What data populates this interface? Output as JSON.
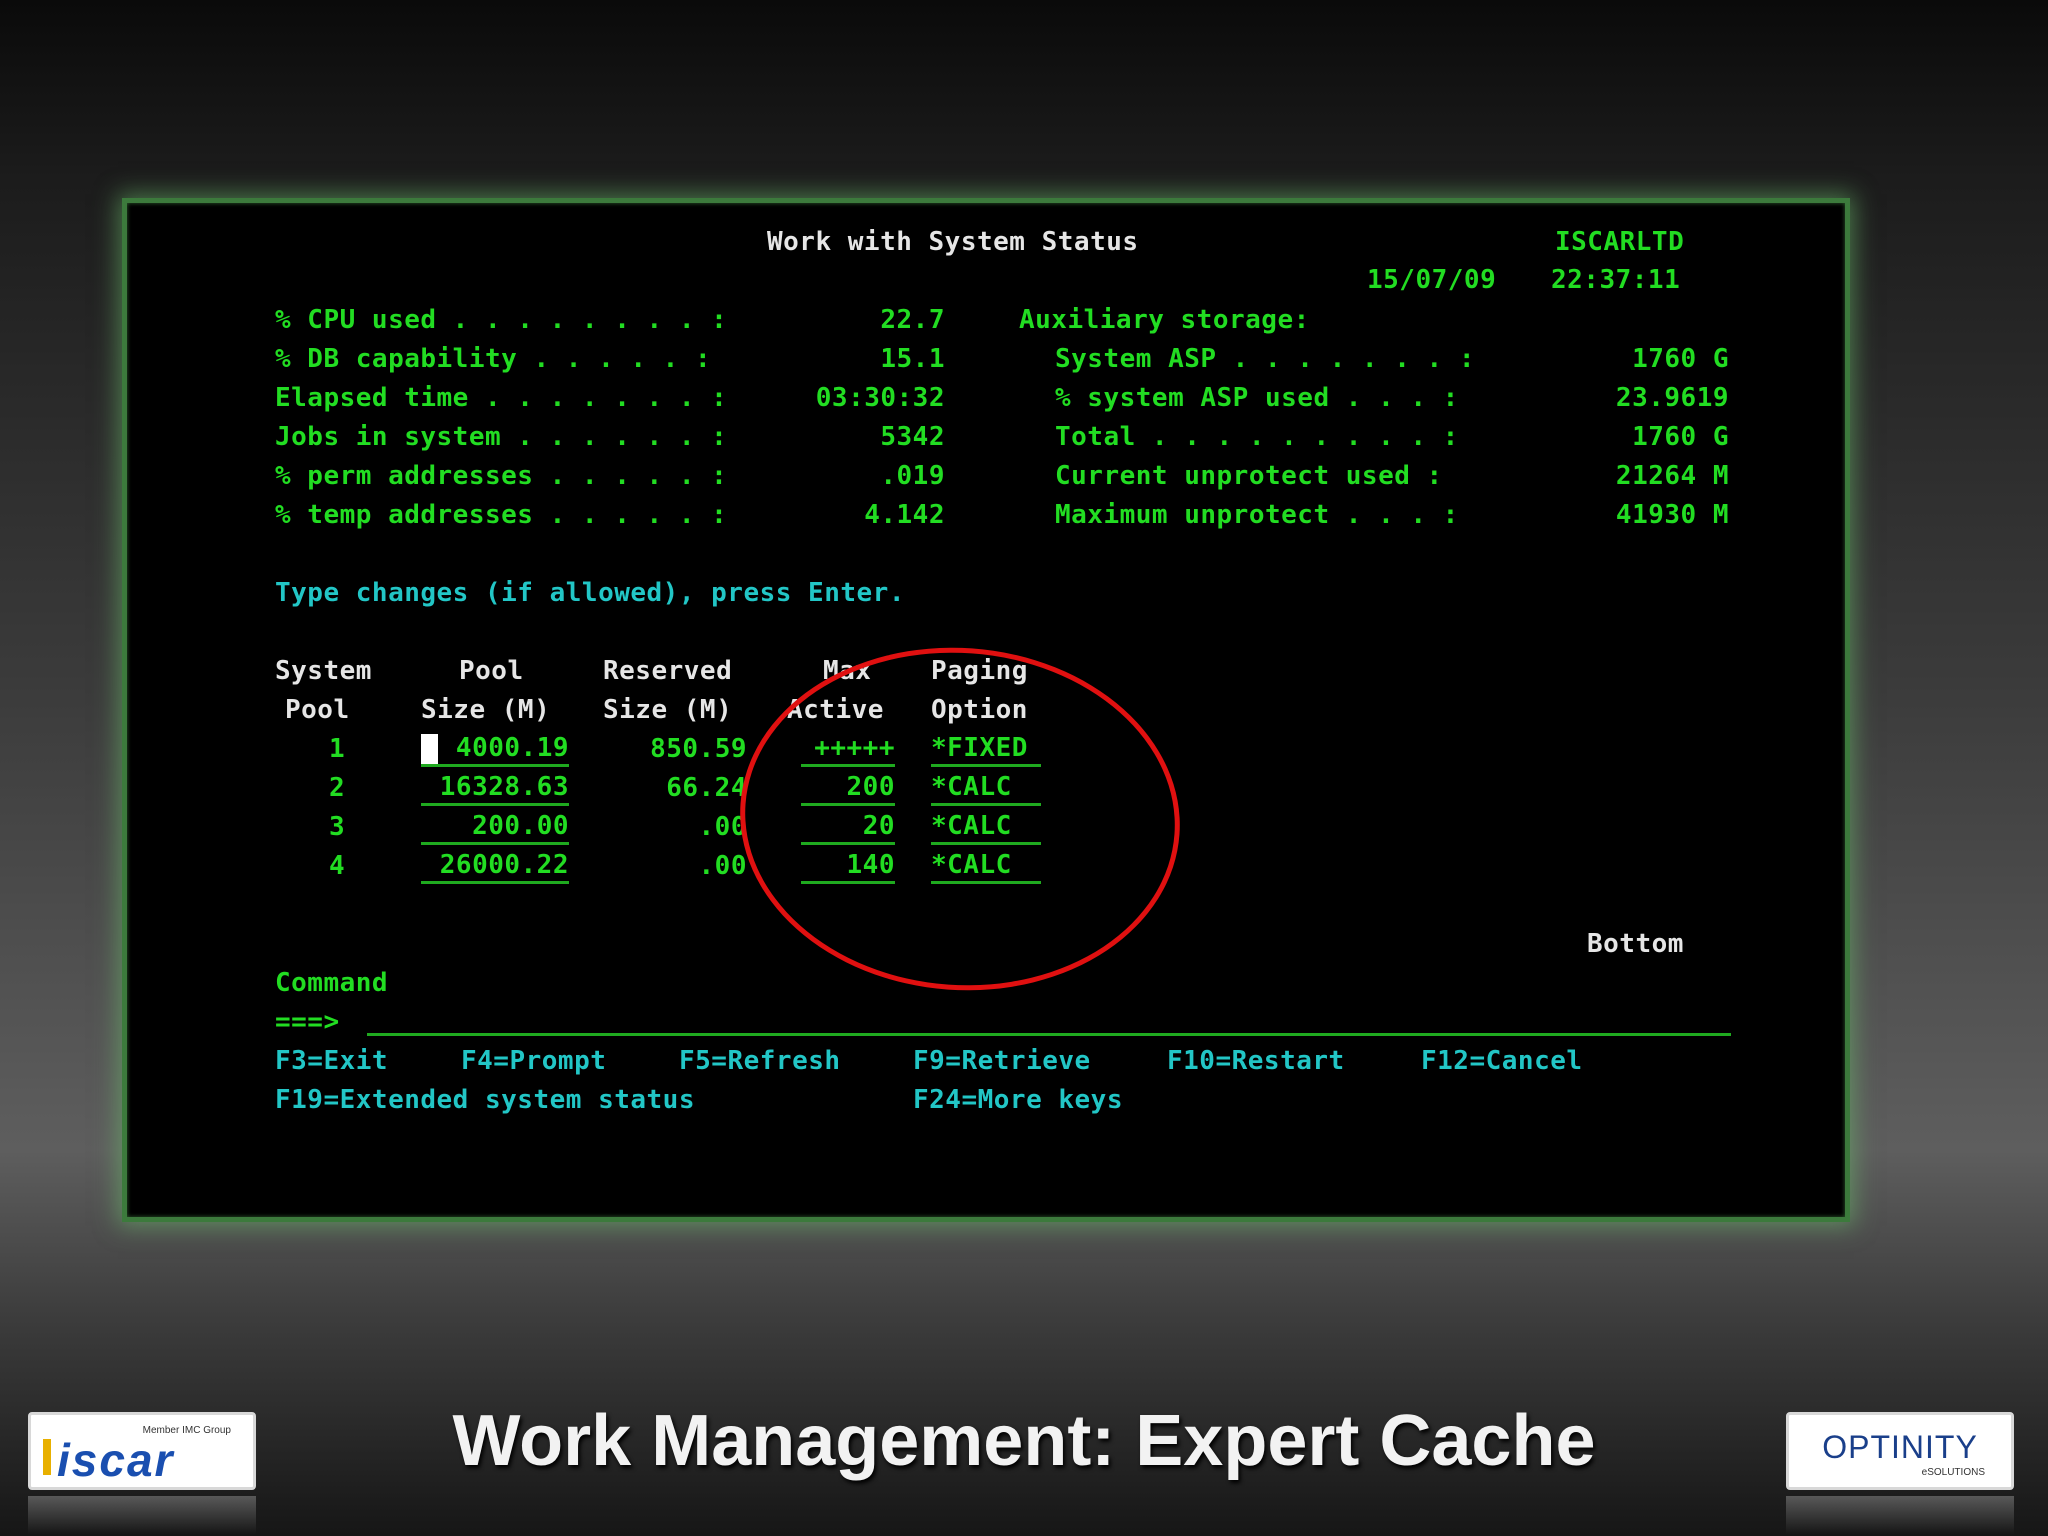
{
  "screen": {
    "title": "Work with System Status",
    "system_name": "ISCARLTD",
    "date": "15/07/09",
    "time": "22:37:11",
    "left_stats": [
      {
        "label": "% CPU used . . . . . . . . :",
        "value": "22.7"
      },
      {
        "label": "% DB capability . . . . . :",
        "value": "15.1"
      },
      {
        "label": "Elapsed time . . . . . . . :",
        "value": "03:30:32"
      },
      {
        "label": "Jobs in system . . . . . . :",
        "value": "5342"
      },
      {
        "label": "% perm addresses . . . . . :",
        "value": ".019"
      },
      {
        "label": "% temp addresses . . . . . :",
        "value": "4.142"
      }
    ],
    "aux_heading": "Auxiliary storage:",
    "right_stats": [
      {
        "label": "System ASP . . . . . . . :",
        "value": "1760 G"
      },
      {
        "label": "% system ASP used . . . :",
        "value": "23.9619"
      },
      {
        "label": "Total . . . . . . . . . :",
        "value": "1760 G"
      },
      {
        "label": "Current unprotect used :",
        "value": "21264 M"
      },
      {
        "label": "Maximum unprotect . . . :",
        "value": "41930 M"
      }
    ],
    "instruction": "Type changes (if allowed), press Enter.",
    "columns": {
      "system": [
        "System",
        "Pool"
      ],
      "pool_size": [
        "Pool",
        "Size (M)"
      ],
      "reserved": [
        "Reserved",
        "Size (M)"
      ],
      "max_active": [
        "Max",
        "Active"
      ],
      "paging": [
        "Paging",
        "Option"
      ]
    },
    "rows": [
      {
        "pool": "1",
        "size": "4000.19",
        "reserved": "850.59",
        "max_active": "+++++",
        "paging": "*FIXED"
      },
      {
        "pool": "2",
        "size": "16328.63",
        "reserved": "66.24",
        "max_active": "200",
        "paging": "*CALC"
      },
      {
        "pool": "3",
        "size": "200.00",
        "reserved": ".00",
        "max_active": "20",
        "paging": "*CALC"
      },
      {
        "pool": "4",
        "size": "26000.22",
        "reserved": ".00",
        "max_active": "140",
        "paging": "*CALC"
      }
    ],
    "bottom_label": "Bottom",
    "command_label": "Command",
    "command_prompt": "===>",
    "fkeys_row1": [
      "F3=Exit",
      "F4=Prompt",
      "F5=Refresh",
      "F9=Retrieve",
      "F10=Restart",
      "F12=Cancel"
    ],
    "fkeys_row2": [
      "F19=Extended system status",
      "F24=More keys"
    ]
  },
  "slide": {
    "title": "Work Management: Expert Cache",
    "left_logo_text": "iscar",
    "left_logo_small": "Member IMC Group",
    "right_logo_text": "OPTINITY",
    "right_logo_small": "eSOLUTIONS"
  },
  "colors": {
    "terminal_green": "#22dd22",
    "terminal_white": "#e6e6e6",
    "terminal_cyan": "#22c6c6",
    "highlight_circle": "#e01010",
    "screen_border": "#3c7a3c"
  }
}
